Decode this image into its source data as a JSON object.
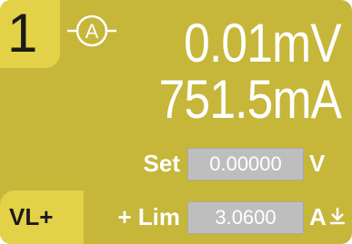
{
  "channel": {
    "number": "1",
    "mode_icon": "auto-range-icon",
    "mode_letter": "A",
    "mode_tag": "VL+"
  },
  "readout": {
    "voltage": "0.01mV",
    "current": "751.5mA"
  },
  "settings": {
    "set_label": "Set",
    "set_value": "0.00000",
    "set_unit": "V",
    "limit_label": "+ Lim",
    "limit_value": "3.0600",
    "limit_unit": "A",
    "limit_icon": "limit-down-arrow-icon"
  },
  "colors": {
    "panel": "#c6b63a",
    "tab": "#e3d147",
    "field": "#bebebe",
    "text": "#ffffff"
  }
}
